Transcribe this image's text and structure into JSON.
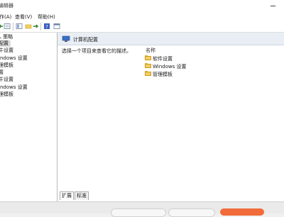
{
  "window": {
    "title": "编辑器"
  },
  "menu": {
    "items": [
      {
        "label": "作(A)"
      },
      {
        "label": "查看(V)"
      },
      {
        "label": "帮助(H)"
      }
    ]
  },
  "toolbar": {
    "icons": [
      "back-arrow-icon",
      "forward-arrow-icon",
      "folder-up-icon",
      "properties-icon",
      "help-icon",
      "view-icon"
    ]
  },
  "tree": {
    "items": [
      {
        "label": "L 策略"
      },
      {
        "label": "配置"
      },
      {
        "label": "牛设置"
      },
      {
        "label": "indows 设置"
      },
      {
        "label": "理模板"
      },
      {
        "label": "置"
      },
      {
        "label": "牛设置"
      },
      {
        "label": "indows 设置"
      },
      {
        "label": "理模板"
      }
    ]
  },
  "right": {
    "header_title": "计算机配置",
    "description": "选择一个项目来查看它的描述。",
    "column_name": "名称",
    "folders": [
      {
        "label": "软件设置"
      },
      {
        "label": "Windows 设置"
      },
      {
        "label": "管理模板"
      }
    ]
  },
  "tabs": {
    "extended": "扩展",
    "standard": "标准"
  },
  "colors": {
    "accent_orange": "#f26b3a",
    "folder_yellow": "#f3cf62",
    "header_bg": "#e9eef5"
  }
}
